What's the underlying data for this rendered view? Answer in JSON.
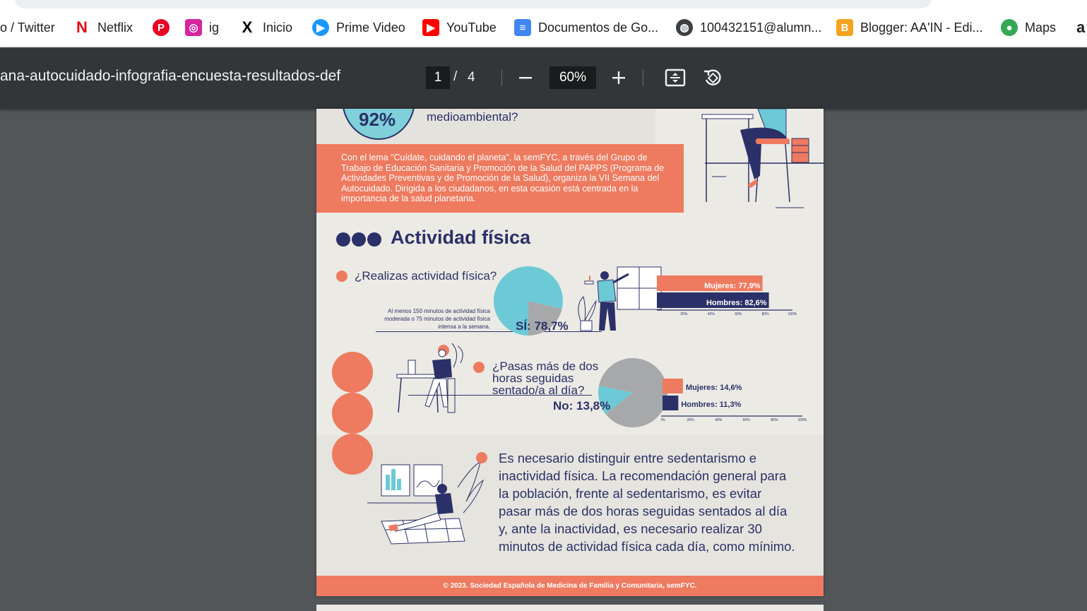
{
  "bookmarks": [
    {
      "label": "o / Twitter",
      "icon": "none"
    },
    {
      "label": "Netflix",
      "icon": "netflix-icon",
      "glyph": "N",
      "color": "#e50914"
    },
    {
      "label": "",
      "icon": "pinterest-icon",
      "glyph": "P",
      "color": "#e60023"
    },
    {
      "label": "ig",
      "icon": "instagram-icon",
      "glyph": "◎",
      "color": "#d6249f"
    },
    {
      "label": "Inicio",
      "icon": "x-twitter-icon",
      "glyph": "X",
      "color": "#000000"
    },
    {
      "label": "Prime Video",
      "icon": "prime-video-icon",
      "glyph": "▶",
      "color": "#1a98ff"
    },
    {
      "label": "YouTube",
      "icon": "youtube-icon",
      "glyph": "▶",
      "color": "#ff0000"
    },
    {
      "label": "Documentos de Go...",
      "icon": "google-docs-icon",
      "glyph": "≡",
      "color": "#4285f4"
    },
    {
      "label": "100432151@alumn...",
      "icon": "globe-icon",
      "glyph": "◍",
      "color": "#3c4043"
    },
    {
      "label": "Blogger: AA'IN - Edi...",
      "icon": "blogger-icon",
      "glyph": "B",
      "color": "#f4a31f"
    },
    {
      "label": "Maps",
      "icon": "maps-icon",
      "glyph": "●",
      "color": "#34a853"
    },
    {
      "label": "a",
      "icon": "amazon-icon",
      "glyph": "",
      "color": "#000000"
    }
  ],
  "pdf_toolbar": {
    "title": "ana-autocuidado-infografia-encuesta-resultados-def",
    "current_page": "1",
    "separator": "/",
    "total_pages": "4",
    "zoom": "60%",
    "zoom_out_icon": "minus-icon",
    "zoom_in_icon": "plus-icon",
    "fit_icon": "fit-page-icon",
    "rotate_icon": "rotate-icon"
  },
  "page": {
    "top_percent": "92%",
    "top_question_tail": "medioambiental?",
    "intro": "Con el lema “Cuídate, cuidando el planeta”, la semFYC, a través del Grupo de Trabajo de Educación Sanitaria y Promoción de la Salud del PAPPS (Programa de Actividades Preventivas y de Promoción de la Salud), organiza la VII Semana del Autocuidado. Dirigida a los ciudadanos, en esta ocasión está centrada en la importancia de la salud planetaria.",
    "section_title": "Actividad física",
    "q1": "¿Realizas actividad física?",
    "q1_note": "Al menos 150 minutos de actividad física moderada o 75 minutos de actividad física intensa a la semana.",
    "q2_line1": "¿Pasas más de dos",
    "q2_line2": "horas seguidas",
    "q2_line3": "sentado/a al día?",
    "body_text": "Es necesario distinguir entre sedentarismo e inactividad física. La recomendación general para la población, frente al sedentarismo, es evitar pasar más de dos horas seguidas sentados al día y, ante la inactividad, es necesario realizar 30 minutos de actividad física cada día, como mínimo.",
    "footer": "© 2023. Sociedad Española de Medicina de Familia y Comunitaria, semFYC."
  },
  "chart_data": [
    {
      "type": "pie",
      "title": "¿Realizas actividad física?",
      "slices": [
        {
          "label": "Sí",
          "value": 78.7
        },
        {
          "label": "",
          "value": 21.3
        }
      ],
      "label_text": "SÍ: 78,7%",
      "colors": [
        "#6ccad6",
        "#a7a8aa"
      ]
    },
    {
      "type": "bar",
      "orientation": "horizontal",
      "categories": [
        "Mujeres",
        "Hombres"
      ],
      "values": [
        77.9,
        82.6
      ],
      "labels": [
        "Mujeres: 77,9%",
        "Hombres: 82,6%"
      ],
      "colors": [
        "#ee7a5f",
        "#2b3168"
      ],
      "xticks": [
        "20%",
        "40%",
        "60%",
        "80%",
        "100%"
      ],
      "xlim": [
        0,
        100
      ]
    },
    {
      "type": "pie",
      "title": "¿Pasas más de dos horas seguidas sentado/a al día?",
      "slices": [
        {
          "label": "No",
          "value": 13.8
        },
        {
          "label": "",
          "value": 86.2
        }
      ],
      "label_text": "No: 13,8%",
      "colors": [
        "#6ccad6",
        "#a7a8aa"
      ]
    },
    {
      "type": "bar",
      "orientation": "horizontal",
      "categories": [
        "Mujeres",
        "Hombres"
      ],
      "values": [
        14.6,
        11.3
      ],
      "labels": [
        "Mujeres: 14,6%",
        "Hombres: 11,3%"
      ],
      "colors": [
        "#ee7a5f",
        "#2b3168"
      ],
      "xticks": [
        "0%",
        "20%",
        "40%",
        "60%",
        "80%",
        "100%"
      ],
      "xlim": [
        0,
        100
      ]
    }
  ]
}
